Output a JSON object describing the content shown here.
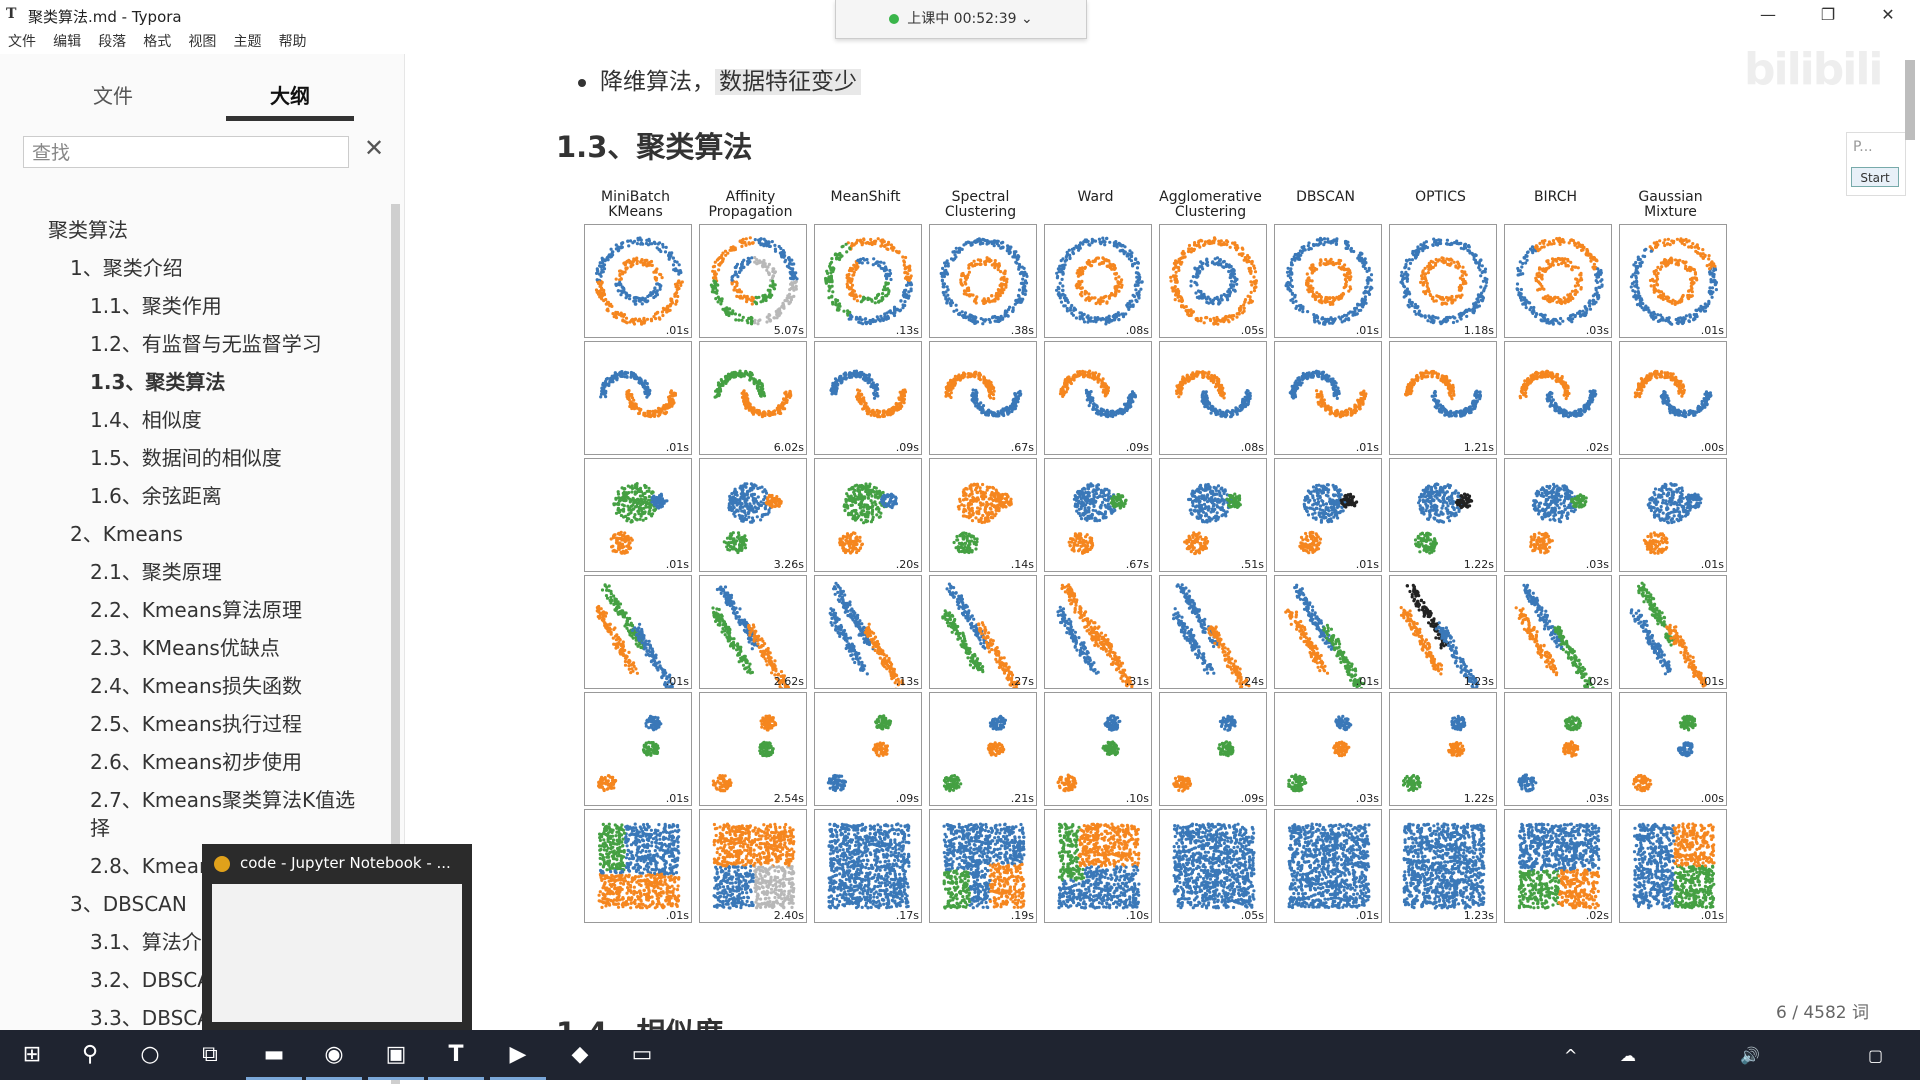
{
  "window": {
    "title": "聚类算法.md - Typora",
    "app_icon": "T",
    "controls": [
      "—",
      "❐",
      "✕"
    ]
  },
  "menu": [
    "文件",
    "编辑",
    "段落",
    "格式",
    "视图",
    "主题",
    "帮助"
  ],
  "class_timer": {
    "label": "上课中 00:52:39",
    "status_color": "#3ab54a"
  },
  "sidebar": {
    "tabs": [
      "文件",
      "大纲"
    ],
    "active_tab": "大纲",
    "search_placeholder": "查找",
    "outline": [
      {
        "label": "聚类算法",
        "level": 0
      },
      {
        "label": "1、聚类介绍",
        "level": 1
      },
      {
        "label": "1.1、聚类作用",
        "level": 2
      },
      {
        "label": "1.2、有监督与无监督学习",
        "level": 2
      },
      {
        "label": "1.3、聚类算法",
        "level": 2,
        "active": true
      },
      {
        "label": "1.4、相似度",
        "level": 2
      },
      {
        "label": "1.5、数据间的相似度",
        "level": 2
      },
      {
        "label": "1.6、余弦距离",
        "level": 2
      },
      {
        "label": "2、Kmeans",
        "level": 1
      },
      {
        "label": "2.1、聚类原理",
        "level": 2
      },
      {
        "label": "2.2、Kmeans算法原理",
        "level": 2
      },
      {
        "label": "2.3、KMeans优缺点",
        "level": 2
      },
      {
        "label": "2.4、Kmeans损失函数",
        "level": 2
      },
      {
        "label": "2.5、Kmeans执行过程",
        "level": 2
      },
      {
        "label": "2.6、Kmeans初步使用",
        "level": 2
      },
      {
        "label": "2.7、Kmeans聚类算法K值选",
        "level": 2
      },
      {
        "label": "择",
        "level": 2
      },
      {
        "label": "2.8、Kmean",
        "level": 2
      },
      {
        "label": "3、DBSCAN",
        "level": 1
      },
      {
        "label": "3.1、算法介",
        "level": 2
      },
      {
        "label": "3.2、DBSCA",
        "level": 2
      },
      {
        "label": "3.3、DBSCA",
        "level": 2
      }
    ],
    "preview_popup": {
      "title": "code - Jupyter Notebook - ..."
    }
  },
  "content": {
    "bullet_text": "降维算法，",
    "bullet_highlight": "数据特征变少",
    "heading": "1.3、聚类算法",
    "next_heading": "1.4、相似度",
    "word_count": "6 / 4582 词",
    "watermark": "bilibili",
    "side_panel": {
      "input": "P...",
      "button": "Start"
    }
  },
  "colors": {
    "blue": "#3a78b8",
    "orange": "#f5861f",
    "green": "#45a043",
    "gray": "#b8b8b8",
    "black": "#222222"
  },
  "grid": {
    "columns": [
      "MiniBatch KMeans",
      "Affinity Propagation",
      "MeanShift",
      "Spectral Clustering",
      "Ward",
      "Agglomerative Clustering",
      "DBSCAN",
      "OPTICS",
      "BIRCH",
      "Gaussian Mixture"
    ],
    "times": [
      [
        ".01s",
        "5.07s",
        ".13s",
        ".38s",
        ".08s",
        ".05s",
        ".01s",
        "1.18s",
        ".03s",
        ".01s"
      ],
      [
        ".01s",
        "6.02s",
        ".09s",
        ".67s",
        ".09s",
        ".08s",
        ".01s",
        "1.21s",
        ".02s",
        ".00s"
      ],
      [
        ".01s",
        "3.26s",
        ".20s",
        ".14s",
        ".67s",
        ".51s",
        ".01s",
        "1.22s",
        ".03s",
        ".01s"
      ],
      [
        ".01s",
        "2.62s",
        ".13s",
        ".27s",
        ".31s",
        ".24s",
        ".01s",
        "1.23s",
        ".02s",
        ".01s"
      ],
      [
        ".01s",
        "2.54s",
        ".09s",
        ".21s",
        ".10s",
        ".09s",
        ".03s",
        "1.22s",
        ".03s",
        ".00s"
      ],
      [
        ".01s",
        "2.40s",
        ".17s",
        ".19s",
        ".10s",
        ".05s",
        ".01s",
        "1.23s",
        ".02s",
        ".01s"
      ]
    ]
  },
  "taskbar": {
    "icons": [
      "windows-logo",
      "search",
      "cortana",
      "task-view",
      "file-explorer",
      "chrome",
      "photos",
      "typora",
      "powerpoint",
      "media-player",
      "terminal"
    ],
    "tray": [
      "^",
      "☁",
      "🔊"
    ]
  }
}
